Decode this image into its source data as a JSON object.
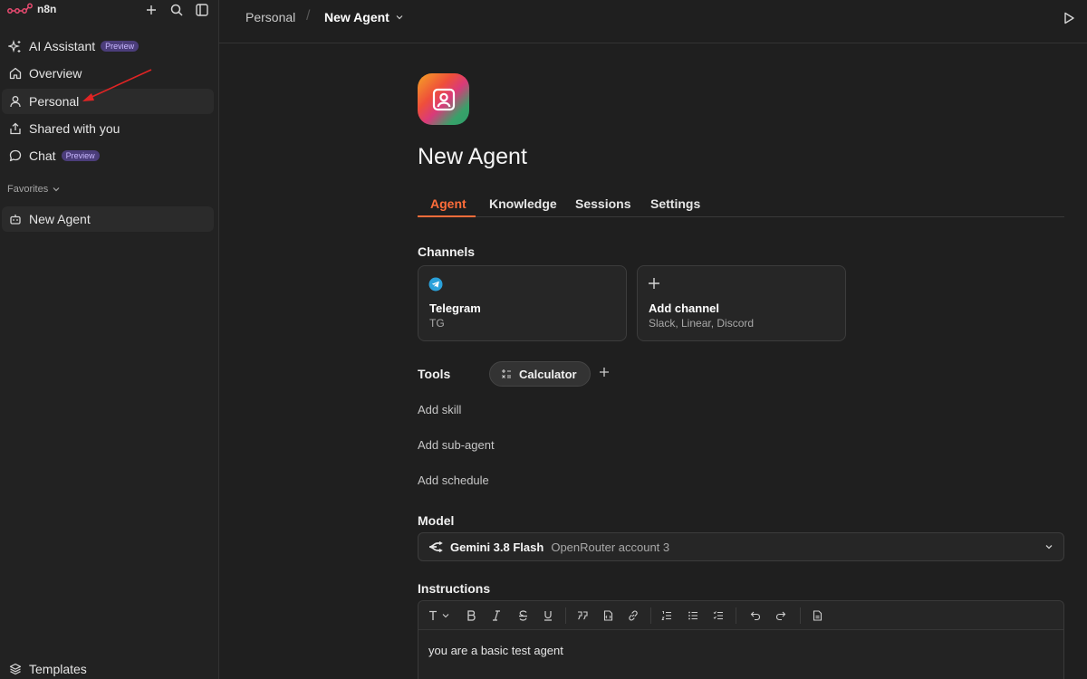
{
  "app": {
    "logo_text": "n8n"
  },
  "sidebar": {
    "items": [
      {
        "label": "AI Assistant",
        "badge": "Preview",
        "icon": "sparkles-icon"
      },
      {
        "label": "Overview",
        "icon": "home-icon"
      },
      {
        "label": "Personal",
        "icon": "user-icon",
        "active": true
      },
      {
        "label": "Shared with you",
        "icon": "share-icon"
      },
      {
        "label": "Chat",
        "badge": "Preview",
        "icon": "chat-icon"
      }
    ],
    "favorites_label": "Favorites",
    "favorites": [
      {
        "label": "New Agent",
        "icon": "robot-icon"
      }
    ],
    "templates_label": "Templates"
  },
  "header": {
    "breadcrumb_parent": "Personal",
    "breadcrumb_separator": "/",
    "breadcrumb_current": "New Agent"
  },
  "agent": {
    "title": "New Agent",
    "tabs": [
      {
        "label": "Agent",
        "active": true
      },
      {
        "label": "Knowledge"
      },
      {
        "label": "Sessions"
      },
      {
        "label": "Settings"
      }
    ],
    "channels_label": "Channels",
    "channels": [
      {
        "title": "Telegram",
        "subtitle": "TG",
        "icon": "telegram-icon"
      },
      {
        "title": "Add channel",
        "subtitle": "Slack, Linear, Discord",
        "icon": "plus-icon"
      }
    ],
    "tools_label": "Tools",
    "tools": [
      {
        "label": "Calculator",
        "icon": "calculator-icon"
      }
    ],
    "add_skill": "Add skill",
    "add_subagent": "Add sub-agent",
    "add_schedule": "Add schedule",
    "model_label": "Model",
    "model": {
      "name": "Gemini 3.8 Flash",
      "account": "OpenRouter account 3"
    },
    "instructions_label": "Instructions",
    "instructions_text": "you are a basic test agent"
  },
  "colors": {
    "accent": "#ff6d3a",
    "badge_bg": "#4b3d7a",
    "annotation_arrow": "#e02424",
    "telegram": "#2aa1da"
  }
}
